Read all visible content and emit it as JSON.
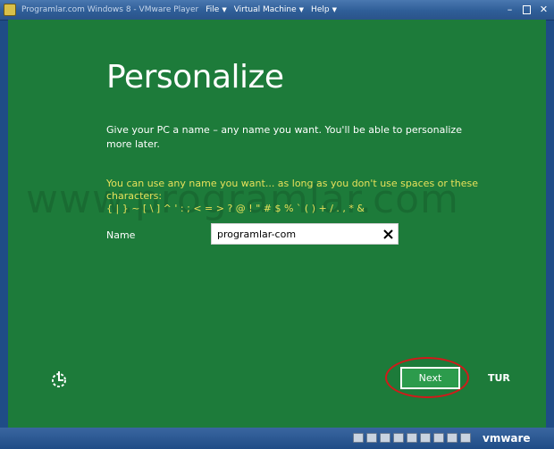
{
  "window": {
    "title": "Programlar.com Windows 8 - VMware Player",
    "menu": [
      {
        "label": "File"
      },
      {
        "label": "Virtual Machine"
      },
      {
        "label": "Help"
      }
    ]
  },
  "setup": {
    "heading": "Personalize",
    "instruction": "Give your PC a name – any name you want. You'll be able to personalize more later.",
    "hint_text": "You can use any name you want... as long as you don't use spaces or these characters:",
    "hint_chars": "{ | } ~ [ \\ ] ^ ' : ; < = > ? @ ! \" # $ % ` ( ) + / . , * &",
    "watermark": "www.programlar.com",
    "name_label": "Name",
    "name_value": "programlar-com",
    "next_label": "Next",
    "language": "TUR"
  },
  "statusbar": {
    "brand": "vmware"
  },
  "colors": {
    "screen_bg": "#1d7b3a",
    "button_bg": "#2c9b4c",
    "hint": "#e7e15a",
    "highlight": "#d11a1a",
    "titlebar": "#2f5e98"
  },
  "icons": [
    "app-icon",
    "minimize-icon",
    "maximize-icon",
    "close-icon",
    "clear-input-icon",
    "ease-of-access-icon"
  ]
}
